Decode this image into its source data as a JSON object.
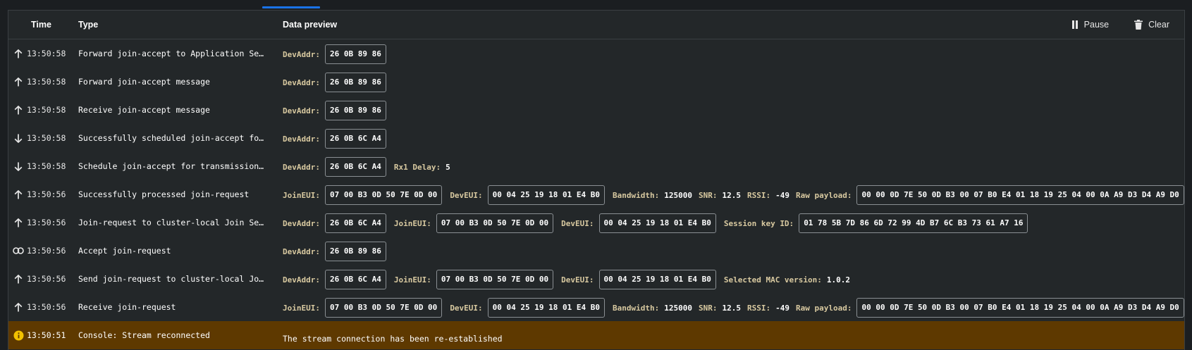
{
  "header": {
    "time": "Time",
    "type": "Type",
    "data_preview": "Data preview",
    "pause_label": "Pause",
    "clear_label": "Clear"
  },
  "colors": {
    "accent": "#1a73e8",
    "warning_row": "#5e3900",
    "warning_icon": "#f2c200"
  },
  "rows": [
    {
      "icon": "arrow-up-icon",
      "time": "13:50:58",
      "type": "Forward join-accept to Application Se…",
      "fields": [
        {
          "label": "DevAddr:",
          "value": "26 0B 89 86"
        }
      ]
    },
    {
      "icon": "arrow-up-icon",
      "time": "13:50:58",
      "type": "Forward join-accept message",
      "fields": [
        {
          "label": "DevAddr:",
          "value": "26 0B 89 86"
        }
      ]
    },
    {
      "icon": "arrow-up-icon",
      "time": "13:50:58",
      "type": "Receive join-accept message",
      "fields": [
        {
          "label": "DevAddr:",
          "value": "26 0B 89 86"
        }
      ]
    },
    {
      "icon": "arrow-down-icon",
      "time": "13:50:58",
      "type": "Successfully scheduled join-accept fo…",
      "fields": [
        {
          "label": "DevAddr:",
          "value": "26 0B 6C A4"
        }
      ]
    },
    {
      "icon": "arrow-down-icon",
      "time": "13:50:58",
      "type": "Schedule join-accept for transmission…",
      "fields": [
        {
          "label": "DevAddr:",
          "value": "26 0B 6C A4"
        },
        {
          "label": "Rx1 Delay:",
          "plain": "5"
        }
      ]
    },
    {
      "icon": "arrow-up-icon",
      "time": "13:50:56",
      "type": "Successfully processed join-request",
      "fields": [
        {
          "label": "JoinEUI:",
          "value": "07 00 B3 0D 50 7E 0D 00"
        },
        {
          "label": "DevEUI:",
          "value": "00 04 25 19 18 01 E4 B0"
        },
        {
          "label": "Bandwidth:",
          "plain": "125000"
        },
        {
          "label": "SNR:",
          "plain": "12.5"
        },
        {
          "label": "RSSI:",
          "plain": "-49"
        },
        {
          "label": "Raw payload:",
          "value": "00 00 0D 7E 50 0D B3 00 07 B0 E4 01 18 19 25 04 00 0A A9 D3 D4 A9 D0"
        }
      ]
    },
    {
      "icon": "arrow-up-icon",
      "time": "13:50:56",
      "type": "Join-request to cluster-local Join Se…",
      "fields": [
        {
          "label": "DevAddr:",
          "value": "26 0B 6C A4"
        },
        {
          "label": "JoinEUI:",
          "value": "07 00 B3 0D 50 7E 0D 00"
        },
        {
          "label": "DevEUI:",
          "value": "00 04 25 19 18 01 E4 B0"
        },
        {
          "label": "Session key ID:",
          "value": "01 78 5B 7D 86 6D 72 99 4D B7 6C B3 73 61 A7 16"
        }
      ]
    },
    {
      "icon": "link-icon",
      "time": "13:50:56",
      "type": "Accept join-request",
      "fields": [
        {
          "label": "DevAddr:",
          "value": "26 0B 89 86"
        }
      ]
    },
    {
      "icon": "arrow-up-icon",
      "time": "13:50:56",
      "type": "Send join-request to cluster-local Jo…",
      "fields": [
        {
          "label": "DevAddr:",
          "value": "26 0B 6C A4"
        },
        {
          "label": "JoinEUI:",
          "value": "07 00 B3 0D 50 7E 0D 00"
        },
        {
          "label": "DevEUI:",
          "value": "00 04 25 19 18 01 E4 B0"
        },
        {
          "label": "Selected MAC version:",
          "plain": "1.0.2"
        }
      ]
    },
    {
      "icon": "arrow-up-icon",
      "time": "13:50:56",
      "type": "Receive join-request",
      "fields": [
        {
          "label": "JoinEUI:",
          "value": "07 00 B3 0D 50 7E 0D 00"
        },
        {
          "label": "DevEUI:",
          "value": "00 04 25 19 18 01 E4 B0"
        },
        {
          "label": "Bandwidth:",
          "plain": "125000"
        },
        {
          "label": "SNR:",
          "plain": "12.5"
        },
        {
          "label": "RSSI:",
          "plain": "-49"
        },
        {
          "label": "Raw payload:",
          "value": "00 00 0D 7E 50 0D B3 00 07 B0 E4 01 18 19 25 04 00 0A A9 D3 D4 A9 D0"
        }
      ]
    },
    {
      "icon": "info-icon",
      "time": "13:50:51",
      "type": "Console: Stream reconnected",
      "warning": true,
      "message": "The stream connection has been re-established"
    }
  ]
}
